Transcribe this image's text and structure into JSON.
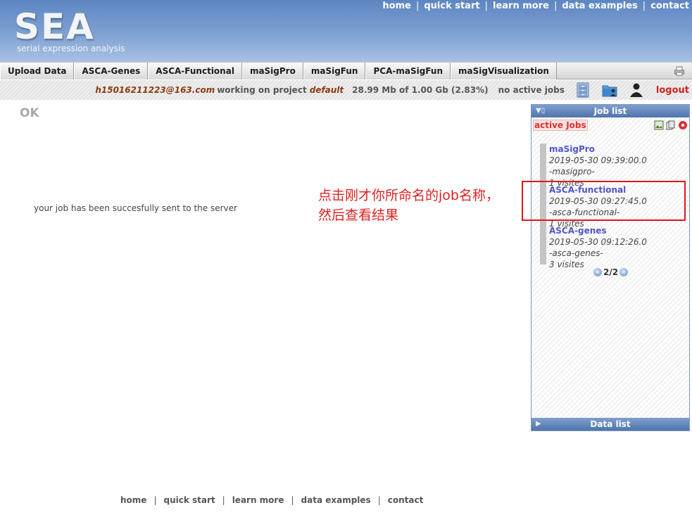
{
  "header": {
    "logo_title": "SEA",
    "logo_subtitle": "serial expression analysis",
    "nav": [
      "home",
      "quick start",
      "learn more",
      "data examples",
      "contact"
    ]
  },
  "tabs": [
    "Upload Data",
    "ASCA-Genes",
    "ASCA-Functional",
    "maSigPro",
    "maSigFun",
    "PCA-maSigFun",
    "maSigVisualization"
  ],
  "status": {
    "user_email": "h15016211223@163.com",
    "working_text": "working on project",
    "project": "default",
    "quota": "28.99 Mb of 1.00 Gb (2.83%)",
    "jobs_text": "no active jobs",
    "logout": "logout",
    "icons": [
      "file-cabinet-icon",
      "folder-user-icon",
      "user-icon"
    ]
  },
  "main": {
    "heading": "OK",
    "message": "your job has been succesfully sent to the server"
  },
  "annotation": {
    "line1": "点击刚才你所命名的job名称，",
    "line2": "然后查看结果"
  },
  "job_panel": {
    "title": "Job list",
    "active_label": "active Jobs",
    "jobs": [
      {
        "name": "maSigPro",
        "date": "2019-05-30 09:39:00.0",
        "desc": "-masigpro-",
        "visits": "1 visites"
      },
      {
        "name": "ASCA-functional",
        "date": "2019-05-30 09:27:45.0",
        "desc": "-asca-functional-",
        "visits": "1 visites"
      },
      {
        "name": "ASCA-genes",
        "date": "2019-05-30 09:12:26.0",
        "desc": "-asca-genes-",
        "visits": "3 visites"
      }
    ],
    "pager": "2/2",
    "data_list_title": "Data list"
  },
  "footer": {
    "links": [
      "home",
      "quick start",
      "learn more",
      "data examples",
      "contact"
    ]
  },
  "colors": {
    "header_blue": "#7fa1d2",
    "panel_header": "#4f74ac",
    "logout_red": "#d02020",
    "annotation_red": "#e02020",
    "job_link": "#4f55c8",
    "user_brown": "#8a3c10"
  }
}
